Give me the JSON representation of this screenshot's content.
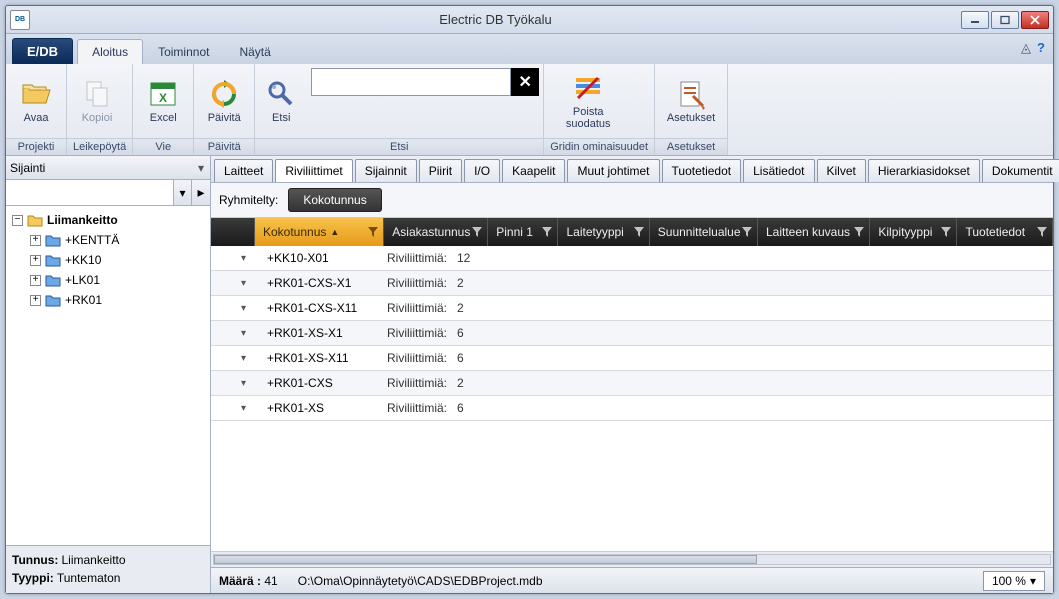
{
  "window": {
    "title": "Electric DB Työkalu"
  },
  "ribbon": {
    "app_menu": "E/DB",
    "tabs": [
      "Aloitus",
      "Toiminnot",
      "Näytä"
    ],
    "active_tab": 0,
    "groups": {
      "projekti": {
        "label": "Projekti",
        "buttons": {
          "avaa": "Avaa"
        }
      },
      "leikepoyta": {
        "label": "Leikepöytä",
        "buttons": {
          "kopioi": "Kopioi"
        }
      },
      "vie": {
        "label": "Vie",
        "buttons": {
          "excel": "Excel"
        }
      },
      "paivita": {
        "label": "Päivitä",
        "buttons": {
          "paivita": "Päivitä"
        }
      },
      "etsi": {
        "label": "Etsi",
        "buttons": {
          "etsi": "Etsi"
        },
        "search_value": ""
      },
      "grid": {
        "label": "Gridin ominaisuudet",
        "buttons": {
          "poista_suodatus": "Poista\nsuodatus"
        }
      },
      "asetukset": {
        "label": "Asetukset",
        "buttons": {
          "asetukset": "Asetukset"
        }
      }
    }
  },
  "sidebar": {
    "mode_label": "Sijainti",
    "filter_value": "",
    "tree": {
      "root": {
        "label": "Liimankeitto"
      },
      "children": [
        {
          "label": "+KENTTÄ"
        },
        {
          "label": "+KK10"
        },
        {
          "label": "+LK01"
        },
        {
          "label": "+RK01"
        }
      ]
    },
    "info": {
      "tunnus_label": "Tunnus:",
      "tunnus_value": "Liimankeitto",
      "tyyppi_label": "Tyyppi:",
      "tyyppi_value": "Tuntematon"
    }
  },
  "content": {
    "tabs": [
      "Laitteet",
      "Riviliittimet",
      "Sijainnit",
      "Piirit",
      "I/O",
      "Kaapelit",
      "Muut johtimet",
      "Tuotetiedot",
      "Lisätiedot",
      "Kilvet",
      "Hierarkiasidokset",
      "Dokumentit"
    ],
    "active_tab": 1,
    "group_label": "Ryhmitelty:",
    "group_field": "Kokotunnus",
    "columns": [
      "Kokotunnus",
      "Asiakastunnus",
      "Pinni 1",
      "Laitetyyppi",
      "Suunnittelualue",
      "Laitteen kuvaus",
      "Kilpityyppi",
      "Tuotetiedot"
    ],
    "sort_col": 0,
    "count_word": "Riviliittimiä:",
    "rows": [
      {
        "code": "+KK10-X01",
        "count": 12
      },
      {
        "code": "+RK01-CXS-X1",
        "count": 2
      },
      {
        "code": "+RK01-CXS-X11",
        "count": 2
      },
      {
        "code": "+RK01-XS-X1",
        "count": 6
      },
      {
        "code": "+RK01-XS-X11",
        "count": 6
      },
      {
        "code": "+RK01-CXS",
        "count": 2
      },
      {
        "code": "+RK01-XS",
        "count": 6
      }
    ]
  },
  "status": {
    "count_label": "Määrä :",
    "count_value": 41,
    "path": "O:\\Oma\\Opinnäytetyö\\CADS\\EDBProject.mdb",
    "zoom": "100 %"
  }
}
